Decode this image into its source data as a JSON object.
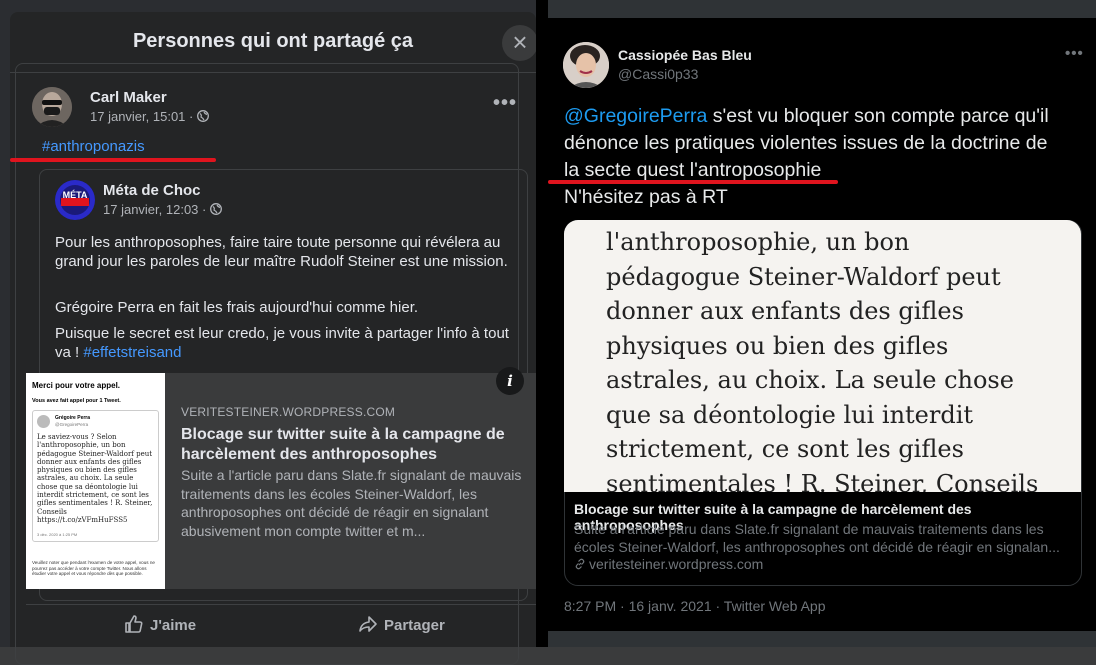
{
  "facebook": {
    "modal_title": "Personnes qui ont partagé ça",
    "close_glyph": "×",
    "post": {
      "author": "Carl Maker",
      "meta": "17 janvier, 15:01 · ",
      "more_glyph": "•••",
      "hashtag": "#anthroponazis",
      "shared": {
        "author": "Méta de Choc",
        "avatar_text": "MÉTA",
        "meta": "17 janvier, 12:03 · ",
        "paragraph1": "Pour les anthroposophes, faire taire toute personne qui révélera au grand jour les paroles de leur maître Rudolf Steiner est une mission.",
        "paragraph2": "Grégoire Perra en fait les frais aujourd'hui comme hier.",
        "paragraph3_text": "Puisque le secret est leur credo, je vous invite à partager l'info à tout va ! ",
        "paragraph3_link": "#effetstreisand"
      },
      "link_card": {
        "domain": "VERITESTEINER.WORDPRESS.COM",
        "title": "Blocage sur twitter suite à la campagne de harcèlement des anthroposophes",
        "description": "Suite a l'article paru dans Slate.fr signalant de mauvais traitements dans les écoles Steiner-Waldorf, les anthroposophes ont décidé de réagir en signalant abusivement mon compte twitter et m...",
        "info_glyph": "i",
        "thumbnail": {
          "heading": "Merci pour votre appel.",
          "subheading": "Vous avez fait appel pour 1 Tweet.",
          "quoted_name": "Grégoire Perra",
          "quoted_handle": "@GregoirePerra",
          "quoted_text": "Le saviez-vous ? Selon l'anthroposophie, un bon pédagogue Steiner-Waldorf peut donner aux enfants des gifles physiques ou bien des gifles astrales, au choix. La seule chose que sa déontologie lui interdit strictement, ce sont les gifles sentimentales ! R. Steiner, Conseils https://t.co/zVFmHuFSS5",
          "quoted_date": "3 déc. 2020 à 1:25 PM",
          "footer": "Veuillez noter que pendant l'examen de votre appel, vous ne pourrez pas accéder à votre compte Twitter. Nous allons étudier votre appel et vous répondre dès que possible."
        }
      },
      "actions": {
        "like": "J'aime",
        "share": "Partager"
      }
    }
  },
  "twitter": {
    "author": "Cassiopée Bas Bleu",
    "handle": "@Cassi0p33",
    "more_glyph": "•••",
    "mention": "@GregoirePerra",
    "tweet_line1_rest": " s'est vu bloquer son compte parce qu'il",
    "tweet_line2": "dénonce les pratiques violentes issues de la doctrine de",
    "tweet_line3": "la secte quest l'antroposophie",
    "tweet_line4": "N'hésitez pas à RT",
    "card": {
      "image_text_lines": [
        "l'anthroposophie, un bon",
        "pédagogue Steiner-Waldorf peut",
        "donner aux enfants des gifles",
        "physiques ou bien des gifles",
        "astrales, au choix. La seule chose",
        "que sa déontologie lui interdit",
        "strictement, ce sont les gifles",
        "sentimentales ! R. Steiner, Conseils"
      ],
      "title": "Blocage sur twitter suite à la campagne de harcèlement des anthroposophes",
      "description": "Suite a l'article paru dans Slate.fr signalant de mauvais traitements dans les écoles Steiner-Waldorf, les anthroposophes ont décidé de réagir en signalan...",
      "domain": "veritesteiner.wordpress.com"
    },
    "timestamp": "8:27 PM · 16 janv. 2021 · Twitter Web App"
  }
}
